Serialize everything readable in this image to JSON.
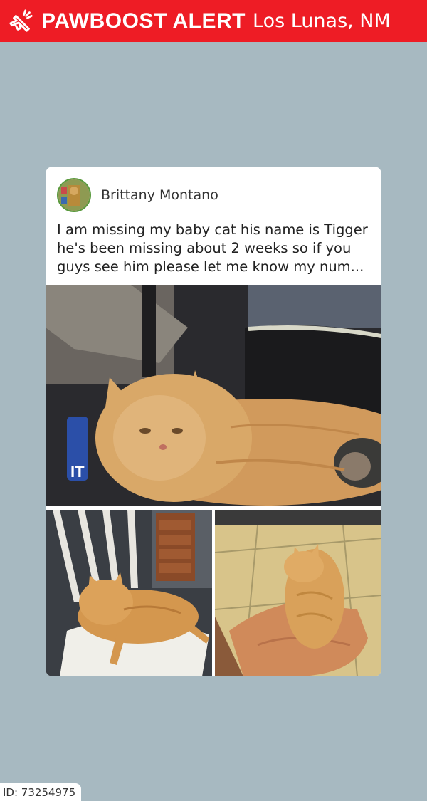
{
  "header": {
    "brand": "PAWBOOST ALERT",
    "location": "Los Lunas, NM",
    "icon": "megaphone-icon",
    "background_color": "#ee1c25"
  },
  "post": {
    "author": "Brittany Montano",
    "text": "I am missing my baby cat his name is Tigger he's been missing about 2 weeks so if you guys see him please let me know my num...",
    "photos": [
      "orange-cat-lying-photo",
      "orange-cat-on-chair-photo",
      "orange-cat-on-towel-photo"
    ]
  },
  "footer": {
    "id_label": "ID: 73254975"
  },
  "colors": {
    "page_background": "#a7b9c1",
    "card_background": "#ffffff"
  }
}
